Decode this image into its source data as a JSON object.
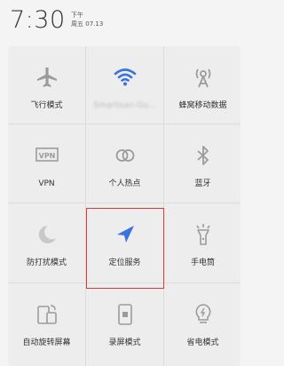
{
  "status": {
    "time": "7:30",
    "period": "下午",
    "weekday": "周五",
    "date": "07.13"
  },
  "tiles": [
    {
      "label": "飞行模式",
      "icon": "airplane-icon",
      "active": false
    },
    {
      "label": "Smartisan-Gu...",
      "icon": "wifi-icon",
      "active": true
    },
    {
      "label": "蜂窝移动数据",
      "icon": "cellular-icon",
      "active": false
    },
    {
      "label": "VPN",
      "icon": "vpn-icon",
      "active": false
    },
    {
      "label": "个人热点",
      "icon": "hotspot-icon",
      "active": false
    },
    {
      "label": "蓝牙",
      "icon": "bluetooth-icon",
      "active": false
    },
    {
      "label": "防打扰模式",
      "icon": "moon-icon",
      "active": false
    },
    {
      "label": "定位服务",
      "icon": "location-icon",
      "active": true
    },
    {
      "label": "手电筒",
      "icon": "flashlight-icon",
      "active": false
    },
    {
      "label": "自动旋转屏幕",
      "icon": "rotate-icon",
      "active": false
    },
    {
      "label": "录屏模式",
      "icon": "screen-record-icon",
      "active": false
    },
    {
      "label": "省电模式",
      "icon": "power-saving-icon",
      "active": false
    }
  ],
  "colors": {
    "active": "#3a73e0",
    "inactive": "#9b9b9b",
    "highlight": "#d83a3a"
  }
}
